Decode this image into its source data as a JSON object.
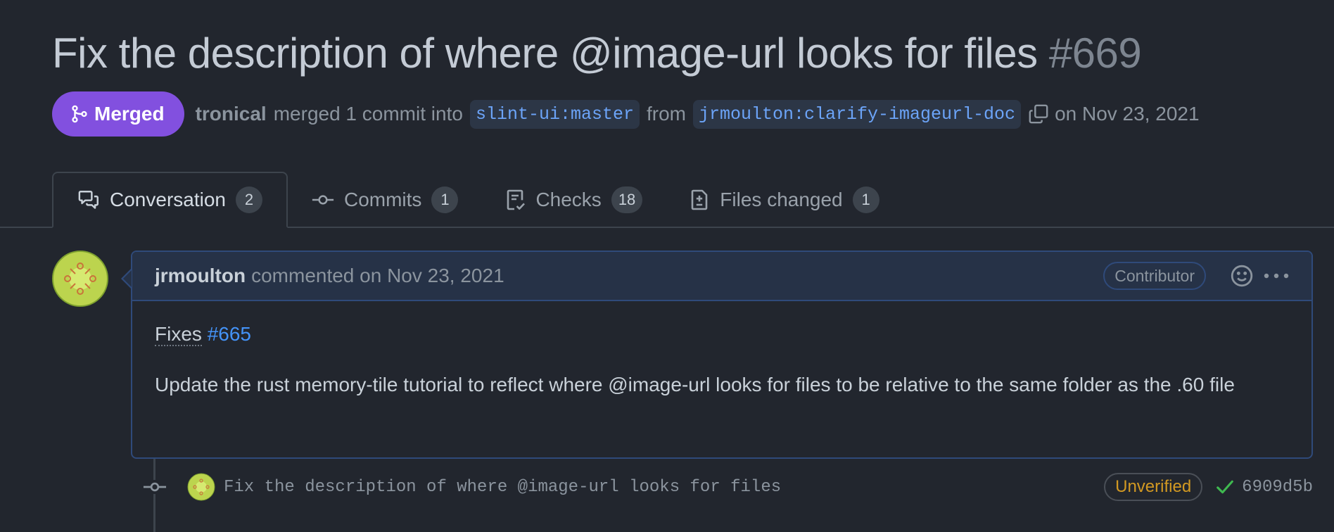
{
  "pr": {
    "title": "Fix the description of where @image-url looks for files",
    "number": "#669",
    "state_label": "Merged",
    "merger": "tronical",
    "merged_text": "merged 1 commit into",
    "base_branch": "slint-ui:master",
    "from_text": "from",
    "head_branch": "jrmoulton:clarify-imageurl-doc",
    "date_text": "on Nov 23, 2021"
  },
  "tabs": [
    {
      "label": "Conversation",
      "count": "2",
      "icon": "comment-discussion-icon"
    },
    {
      "label": "Commits",
      "count": "1",
      "icon": "git-commit-icon"
    },
    {
      "label": "Checks",
      "count": "18",
      "icon": "checklist-icon"
    },
    {
      "label": "Files changed",
      "count": "1",
      "icon": "file-diff-icon"
    }
  ],
  "comment": {
    "author": "jrmoulton",
    "action_text": "commented on Nov 23, 2021",
    "role": "Contributor",
    "fixes_word": "Fixes",
    "issue_ref": "#665",
    "body": "Update the rust memory-tile tutorial to reflect where @image-url looks for files to be relative to the same folder as the .60 file"
  },
  "commit": {
    "message": "Fix the description of where @image-url looks for files",
    "verification": "Unverified",
    "sha": "6909d5b"
  },
  "colors": {
    "background": "#22262e",
    "merged": "#8250df",
    "link": "#4493f8",
    "branch_text": "#6ca4f8",
    "warning": "#d29922",
    "success": "#3fb950"
  }
}
